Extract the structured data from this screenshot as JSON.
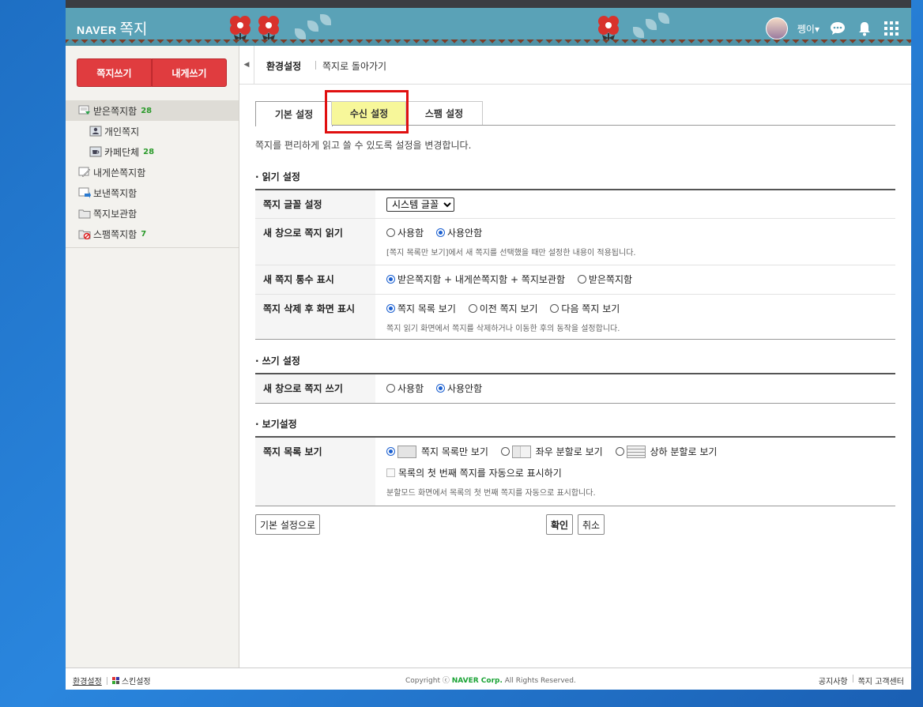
{
  "header": {
    "brand": "NAVER",
    "service": "쪽지",
    "username": "쩽이",
    "user_caret": "▾"
  },
  "sidebar": {
    "write_button": "쪽지쓰기",
    "self_button": "내게쓰기",
    "folders": [
      {
        "label": "받은쪽지함",
        "count": "28"
      },
      {
        "label": "개인쪽지",
        "count": ""
      },
      {
        "label": "카페단체",
        "count": "28"
      },
      {
        "label": "내게쓴쪽지함",
        "count": ""
      },
      {
        "label": "보낸쪽지함",
        "count": ""
      },
      {
        "label": "쪽지보관함",
        "count": ""
      },
      {
        "label": "스팸쪽지함",
        "count": "7"
      }
    ]
  },
  "crumb": {
    "back": "◀",
    "current": "환경설정",
    "link": "쪽지로 돌아가기"
  },
  "tabs": [
    "기본 설정",
    "수신 설정",
    "스팸 설정"
  ],
  "description": "쪽지를 편리하게 읽고 쓸 수 있도록 설정을 변경합니다.",
  "read": {
    "title": "읽기 설정",
    "font_label": "쪽지 글꼴 설정",
    "font_value": "시스템 글꼴",
    "newwin_label": "새 창으로 쪽지 읽기",
    "use": "사용함",
    "nouse": "사용안함",
    "newwin_note": "[쪽지 목록만 보기]에서 새 쪽지를 선택했을 때만 설정한 내용이 적용됩니다.",
    "count_label": "새 쪽지 통수 표시",
    "count_opt1": "받은쪽지함 + 내게쓴쪽지함 + 쪽지보관함",
    "count_opt2": "받은쪽지함",
    "after_label": "쪽지 삭제 후 화면 표시",
    "after_opt1": "쪽지 목록 보기",
    "after_opt2": "이전 쪽지 보기",
    "after_opt3": "다음 쪽지 보기",
    "after_note": "쪽지 읽기 화면에서 쪽지를 삭제하거나 이동한 후의 동작을 설정합니다."
  },
  "write": {
    "title": "쓰기 설정",
    "newwin_label": "새 창으로 쪽지 쓰기",
    "use": "사용함",
    "nouse": "사용안함"
  },
  "view": {
    "title": "보기설정",
    "list_label": "쪽지 목록 보기",
    "opt1": "쪽지 목록만 보기",
    "opt2": "좌우 분할로 보기",
    "opt3": "상하 분할로 보기",
    "auto_check": "목록의 첫 번째 쪽지를 자동으로 표시하기",
    "note": "분할모드 화면에서 목록의 첫 번째 쪽지를 자동으로 표시합니다."
  },
  "buttons": {
    "default": "기본 설정으로",
    "ok": "확인",
    "cancel": "취소"
  },
  "footer": {
    "settings": "환경설정",
    "skin": "스킨설정",
    "copyright_pre": "Copyright ⓒ",
    "corp": "NAVER Corp.",
    "copyright_post": "All Rights Reserved.",
    "notice": "공지사항",
    "help": "쪽지 고객센터"
  }
}
